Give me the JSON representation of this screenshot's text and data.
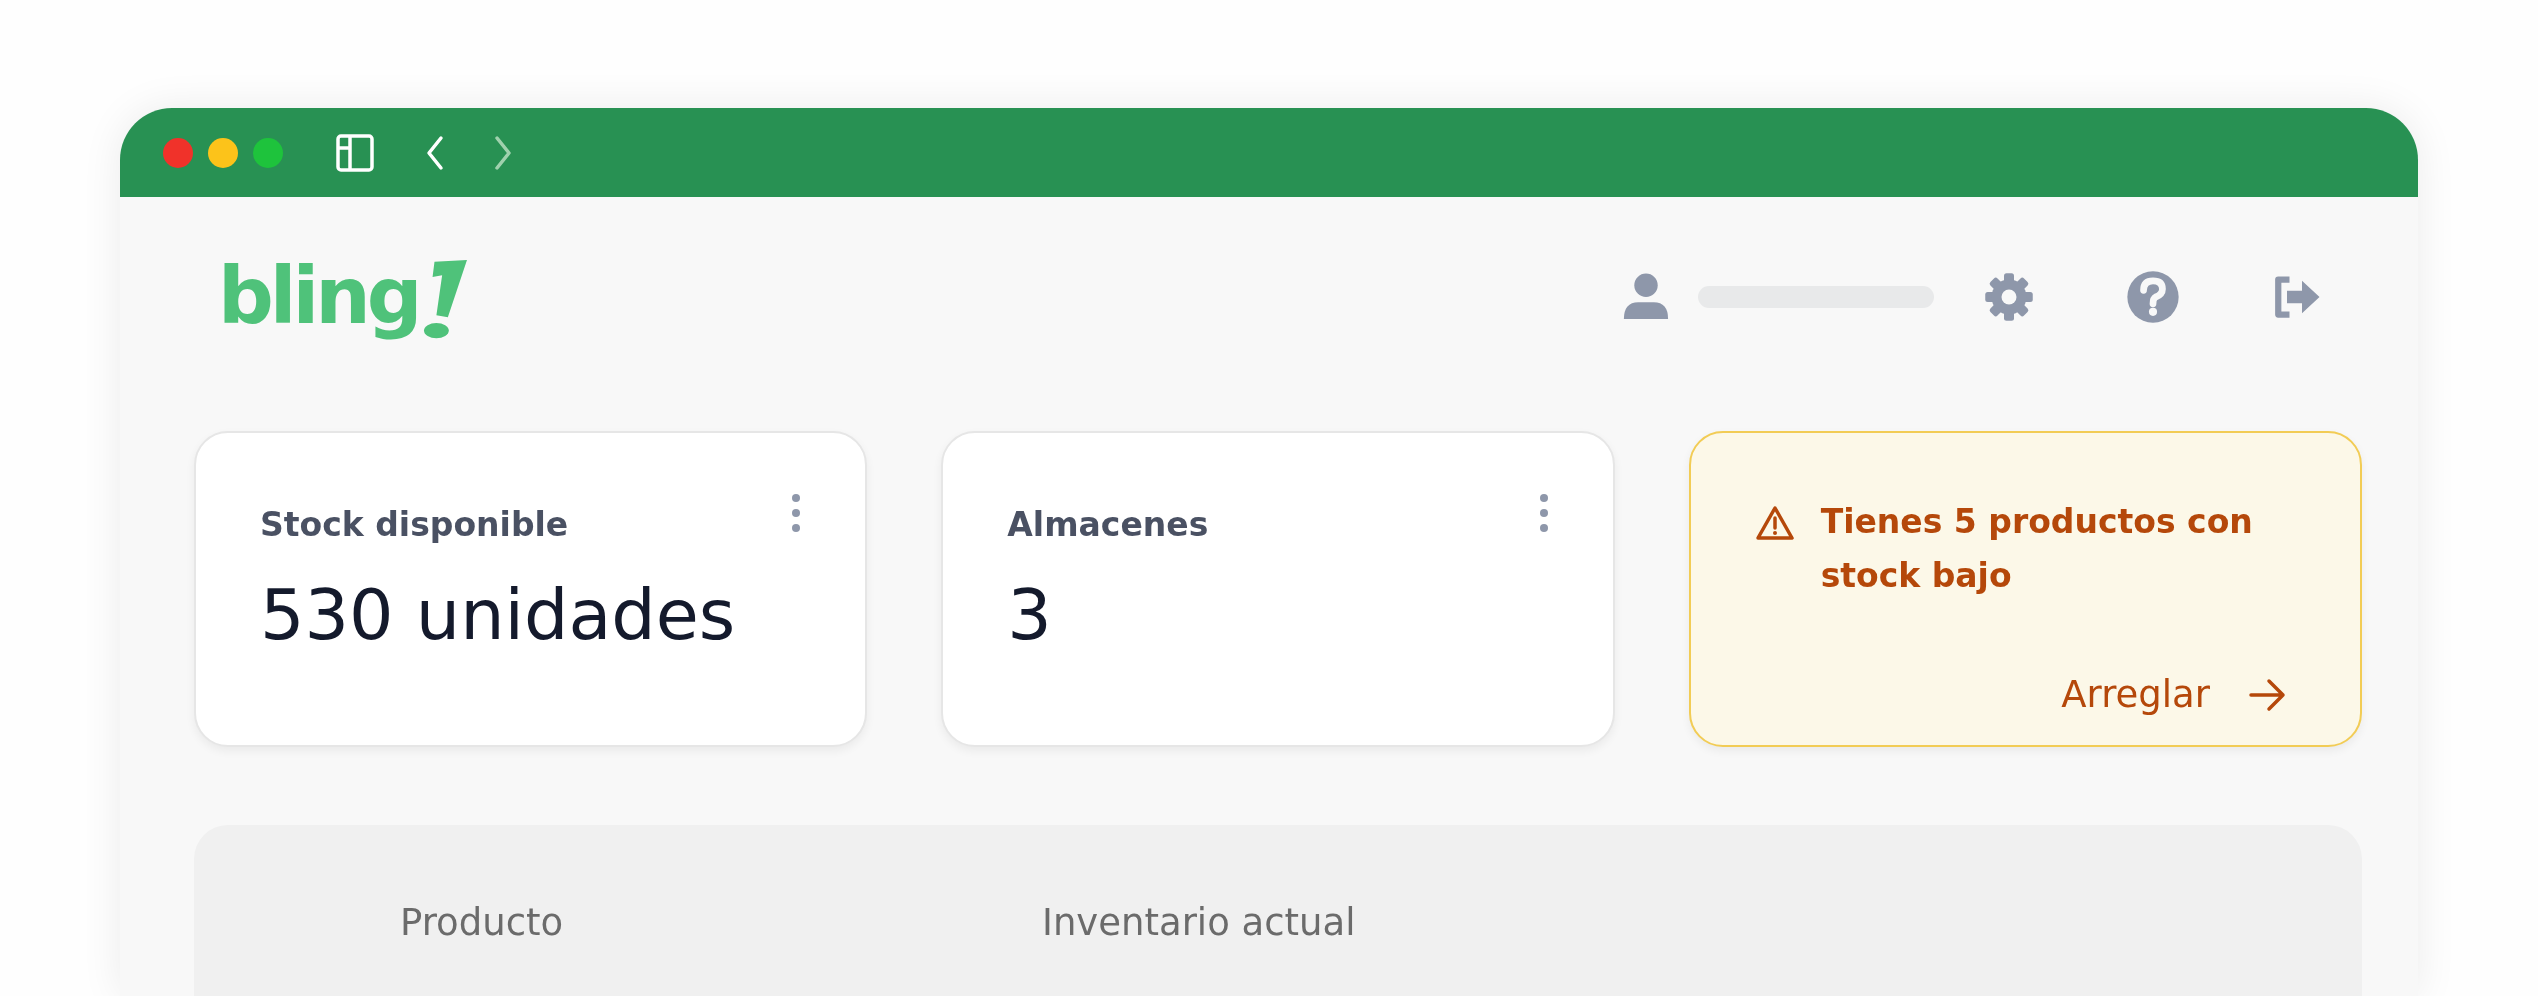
{
  "logo": {
    "text": "bling"
  },
  "cards": [
    {
      "kind": "stat",
      "title": "Stock disponible",
      "value": "530 unidades"
    },
    {
      "kind": "stat",
      "title": "Almacenes",
      "value": "3"
    },
    {
      "kind": "alert",
      "message": "Tienes 5 productos con stock bajo",
      "action": "Arreglar"
    }
  ],
  "table": {
    "columns": [
      "Producto",
      "Inventario actual"
    ]
  }
}
